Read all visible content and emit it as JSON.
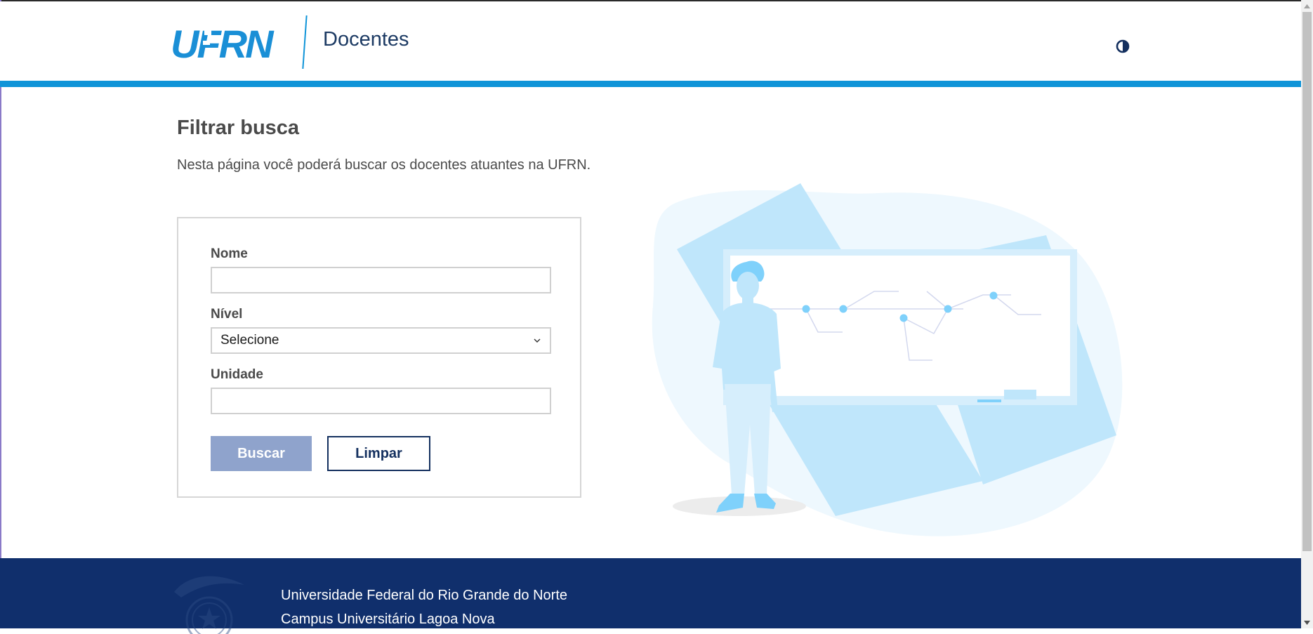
{
  "header": {
    "logo_text": "UFRN",
    "site_title": "Docentes",
    "contrast_icon": "contrast-icon"
  },
  "main": {
    "heading": "Filtrar busca",
    "intro": "Nesta página você poderá buscar os docentes atuantes na UFRN."
  },
  "form": {
    "nome_label": "Nome",
    "nome_value": "",
    "nivel_label": "Nível",
    "nivel_selected": "Selecione",
    "unidade_label": "Unidade",
    "unidade_value": "",
    "buscar_label": "Buscar",
    "limpar_label": "Limpar"
  },
  "footer": {
    "line1": "Universidade Federal do Rio Grande do Norte",
    "line2": "Campus Universitário Lagoa Nova"
  },
  "colors": {
    "accent_blue": "#0f94d8",
    "navy": "#102f6c",
    "button_primary": "#8fa3cc"
  },
  "icons": {
    "select_chevron": "chevron-down-icon",
    "illustration": "teacher-whiteboard-illustration"
  }
}
